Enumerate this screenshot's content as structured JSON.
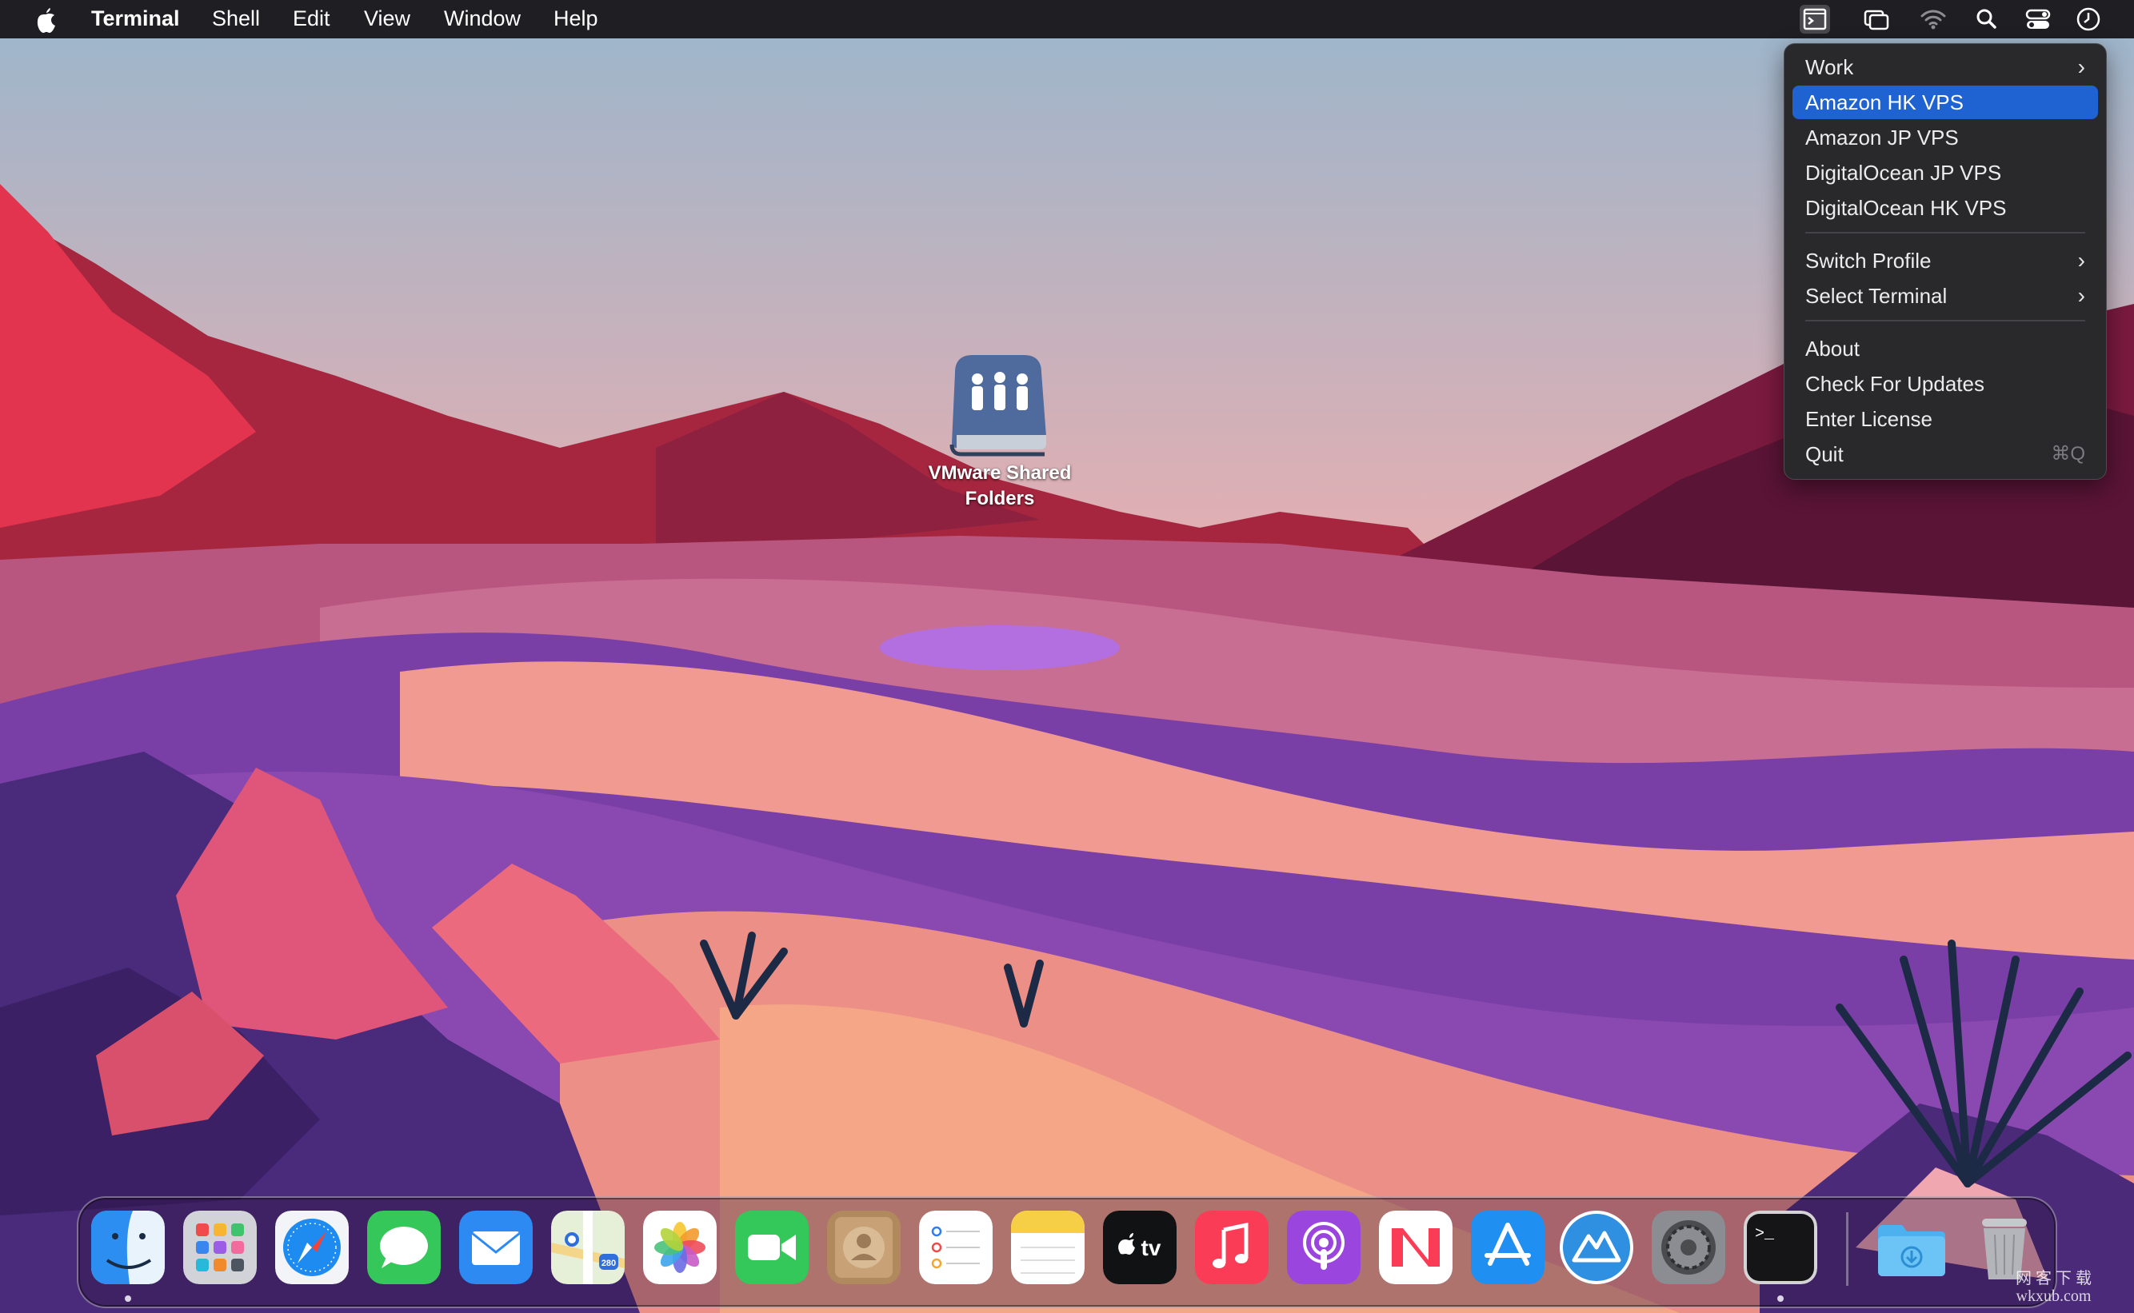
{
  "menubar": {
    "app_name": "Terminal",
    "menus": [
      "Shell",
      "Edit",
      "View",
      "Window",
      "Help"
    ],
    "status_icons": [
      "terminal-menu-icon",
      "screen-mirror-icon",
      "wifi-icon",
      "search-icon",
      "control-center-icon",
      "clock-icon"
    ]
  },
  "dropdown": {
    "items": [
      {
        "label": "Work",
        "submenu": true
      },
      {
        "label": "Amazon HK VPS",
        "highlighted": true
      },
      {
        "label": "Amazon JP VPS"
      },
      {
        "label": "DigitalOcean JP VPS"
      },
      {
        "label": "DigitalOcean HK VPS"
      },
      {
        "label": "Switch Profile",
        "submenu": true
      },
      {
        "label": "Select Terminal",
        "submenu": true
      },
      {
        "label": "About"
      },
      {
        "label": "Check For Updates"
      },
      {
        "label": "Enter License"
      },
      {
        "label": "Quit",
        "shortcut": "⌘Q"
      }
    ],
    "highlight_color": "#1f63d3"
  },
  "desktop_icon": {
    "label_line1": "VMware Shared",
    "label_line2": "Folders"
  },
  "dock": {
    "apps": [
      "Finder",
      "Launchpad",
      "Safari",
      "Messages",
      "Mail",
      "Maps",
      "Photos",
      "FaceTime",
      "Contacts",
      "Reminders",
      "Notes",
      "TV",
      "Music",
      "Podcasts",
      "News",
      "App Store",
      "Core Shell",
      "System Preferences",
      "Terminal",
      "Downloads",
      "Trash"
    ],
    "tv_text": "tv",
    "terminal_prompt": ">_",
    "maps_shield": "280"
  },
  "watermark": {
    "line1": "网 客 下 载",
    "line2": "wkxub.com"
  }
}
